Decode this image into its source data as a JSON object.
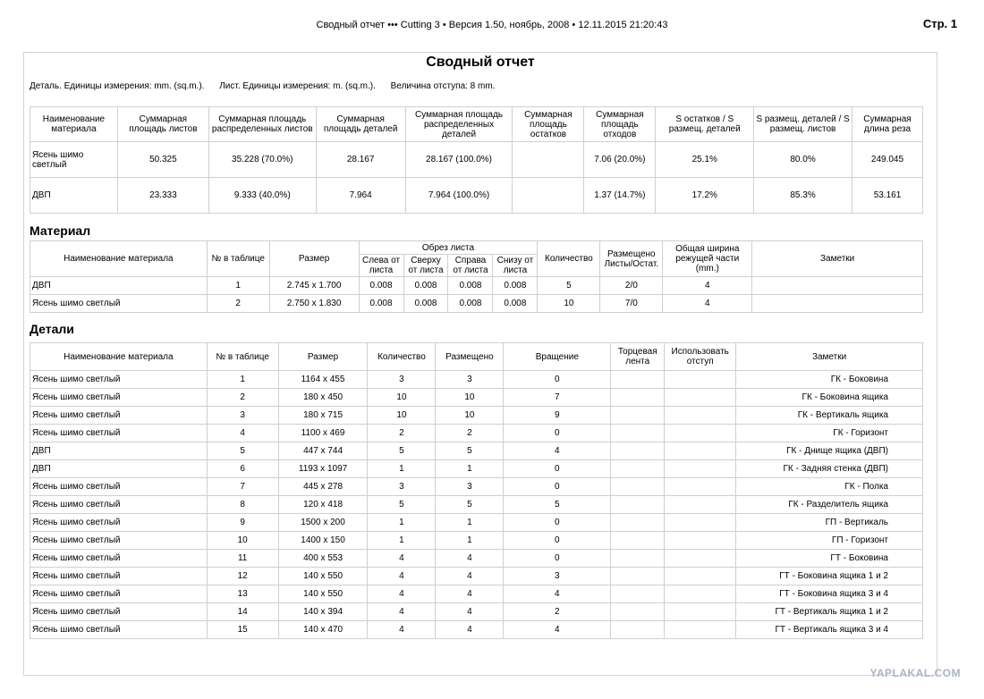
{
  "header": {
    "text": "Сводный отчет ••• Cutting 3 • Версия 1.50, ноябрь, 2008 • 12.11.2015 21:20:43",
    "page": "Стр.  1"
  },
  "report": {
    "title": "Сводный отчет",
    "units_detail": "Деталь. Единицы измерения: mm. (sq.m.).",
    "units_sheet": "Лист. Единицы измерения: m. (sq.m.).",
    "offset": "Величина отступа: 8 mm."
  },
  "summary": {
    "headers": [
      "Наименование материала",
      "Суммарная площадь листов",
      "Суммарная площадь распределенных листов",
      "Суммарная площадь деталей",
      "Суммарная площадь распределенных деталей",
      "Суммарная площадь остатков",
      "Суммарная площадь отходов",
      "S остатков / S размещ. деталей",
      "S размещ. деталей / S размещ. листов",
      "Суммарная длина реза"
    ],
    "rows": [
      [
        "Ясень шимо светлый",
        "50.325",
        "35.228 (70.0%)",
        "28.167",
        "28.167 (100.0%)",
        "",
        "7.06 (20.0%)",
        "25.1%",
        "80.0%",
        "249.045"
      ],
      [
        "ДВП",
        "23.333",
        "9.333 (40.0%)",
        "7.964",
        "7.964 (100.0%)",
        "",
        "1.37 (14.7%)",
        "17.2%",
        "85.3%",
        "53.161"
      ]
    ]
  },
  "material": {
    "section_title": "Материал",
    "headers": {
      "name": "Наименование материала",
      "num": "№ в таблице",
      "size": "Размер",
      "trim_group": "Обрез листа",
      "trim_left": "Слева от листа",
      "trim_top": "Сверху от листа",
      "trim_right": "Справа от листа",
      "trim_bottom": "Снизу от листа",
      "qty": "Количество",
      "placed": "Размещено Листы/Остат.",
      "width": "Общая ширина режущей части (mm.)",
      "notes": "Заметки"
    },
    "rows": [
      [
        "ДВП",
        "1",
        "2.745 x 1.700",
        "0.008",
        "0.008",
        "0.008",
        "0.008",
        "5",
        "2/0",
        "4",
        ""
      ],
      [
        "Ясень шимо светлый",
        "2",
        "2.750 x 1.830",
        "0.008",
        "0.008",
        "0.008",
        "0.008",
        "10",
        "7/0",
        "4",
        ""
      ]
    ]
  },
  "details": {
    "section_title": "Детали",
    "headers": [
      "Наименование материала",
      "№ в таблице",
      "Размер",
      "Количество",
      "Размещено",
      "Вращение",
      "Торцевая лента",
      "Использовать отступ",
      "Заметки"
    ],
    "rows": [
      [
        "Ясень шимо светлый",
        "1",
        "1164 x 455",
        "3",
        "3",
        "0",
        "",
        "",
        "ГК - Боковина"
      ],
      [
        "Ясень шимо светлый",
        "2",
        "180 x 450",
        "10",
        "10",
        "7",
        "",
        "",
        "ГК - Боковина ящика"
      ],
      [
        "Ясень шимо светлый",
        "3",
        "180 x 715",
        "10",
        "10",
        "9",
        "",
        "",
        "ГК - Вертикаль ящика"
      ],
      [
        "Ясень шимо светлый",
        "4",
        "1100 x 469",
        "2",
        "2",
        "0",
        "",
        "",
        "ГК - Горизонт"
      ],
      [
        "ДВП",
        "5",
        "447 x 744",
        "5",
        "5",
        "4",
        "",
        "",
        "ГК - Днище ящика (ДВП)"
      ],
      [
        "ДВП",
        "6",
        "1193 x 1097",
        "1",
        "1",
        "0",
        "",
        "",
        "ГК - Задняя стенка (ДВП)"
      ],
      [
        "Ясень шимо светлый",
        "7",
        "445 x 278",
        "3",
        "3",
        "0",
        "",
        "",
        "ГК - Полка"
      ],
      [
        "Ясень шимо светлый",
        "8",
        "120 x 418",
        "5",
        "5",
        "5",
        "",
        "",
        "ГК - Разделитель ящика"
      ],
      [
        "Ясень шимо светлый",
        "9",
        "1500 x 200",
        "1",
        "1",
        "0",
        "",
        "",
        "ГП - Вертикаль"
      ],
      [
        "Ясень шимо светлый",
        "10",
        "1400 x 150",
        "1",
        "1",
        "0",
        "",
        "",
        "ГП - Горизонт"
      ],
      [
        "Ясень шимо светлый",
        "11",
        "400 x 553",
        "4",
        "4",
        "0",
        "",
        "",
        "ГТ - Боковина"
      ],
      [
        "Ясень шимо светлый",
        "12",
        "140 x 550",
        "4",
        "4",
        "3",
        "",
        "",
        "ГТ - Боковина ящика 1 и 2"
      ],
      [
        "Ясень шимо светлый",
        "13",
        "140 x 550",
        "4",
        "4",
        "4",
        "",
        "",
        "ГТ - Боковина ящика 3 и 4"
      ],
      [
        "Ясень шимо светлый",
        "14",
        "140 x 394",
        "4",
        "4",
        "2",
        "",
        "",
        "ГТ - Вертикаль ящика 1 и 2"
      ],
      [
        "Ясень шимо светлый",
        "15",
        "140 x 470",
        "4",
        "4",
        "4",
        "",
        "",
        "ГТ - Вертикаль ящика 3 и 4"
      ]
    ]
  },
  "watermark": "YAPLAKAL.COM"
}
